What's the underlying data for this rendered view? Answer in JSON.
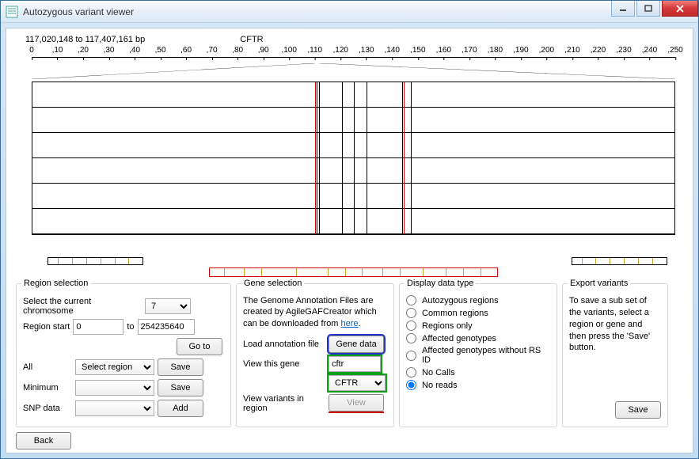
{
  "window": {
    "title": "Autozygous  variant viewer"
  },
  "header": {
    "range": "117,020,148 to 117,407,161 bp",
    "gene": "CFTR"
  },
  "chart_data": {
    "type": "table",
    "ruler": {
      "start": 0,
      "end": 250,
      "step": 10,
      "unit": ""
    },
    "rows": 6,
    "vertical_lines": [
      44.3,
      44.6,
      48.2,
      50.0,
      52.0,
      57.6,
      59.0
    ],
    "red_lines": [
      44.0,
      57.8
    ],
    "highlight_bar": {
      "left_pct": 27.5,
      "width_pct": 45.0
    },
    "bottom_bars": [
      {
        "left_pct": 0,
        "width_pct": 15.5
      },
      {
        "left_pct": 84.5,
        "width_pct": 15.5
      }
    ]
  },
  "region": {
    "title": "Region selection",
    "chrom_label": "Select the current chromosome",
    "chrom_value": "7",
    "start_label": "Region start",
    "start_value": "0",
    "to_label": "to",
    "end_value": "254235640",
    "goto_btn": "Go to",
    "all_label": "All",
    "all_select": "Select region",
    "save_btn": "Save",
    "min_label": "Minimum",
    "snp_label": "SNP data",
    "add_btn": "Add",
    "back_btn": "Back"
  },
  "gene": {
    "title": "Gene selection",
    "text_pre": "The Genome Annotation Files are created by AgileGAFCreator which can be downloaded from ",
    "link": "here",
    "text_post": ".",
    "load_label": "Load annotation file",
    "gene_data_btn": "Gene data",
    "view_gene_label": "View this gene",
    "gene_input": "cftr",
    "gene_select": "CFTR",
    "view_variants_label": "View variants in region",
    "view_btn": "View"
  },
  "display": {
    "title": "Display data type",
    "options": [
      "Autozygous regions",
      "Common regions",
      "Regions only",
      "Affected genotypes",
      "Affected genotypes without RS ID",
      "No Calls",
      "No reads"
    ],
    "selected": "No reads"
  },
  "export": {
    "title": "Export variants",
    "text": "To save a sub set of the variants, select a region or gene and then press the 'Save' button.",
    "save_btn": "Save"
  }
}
